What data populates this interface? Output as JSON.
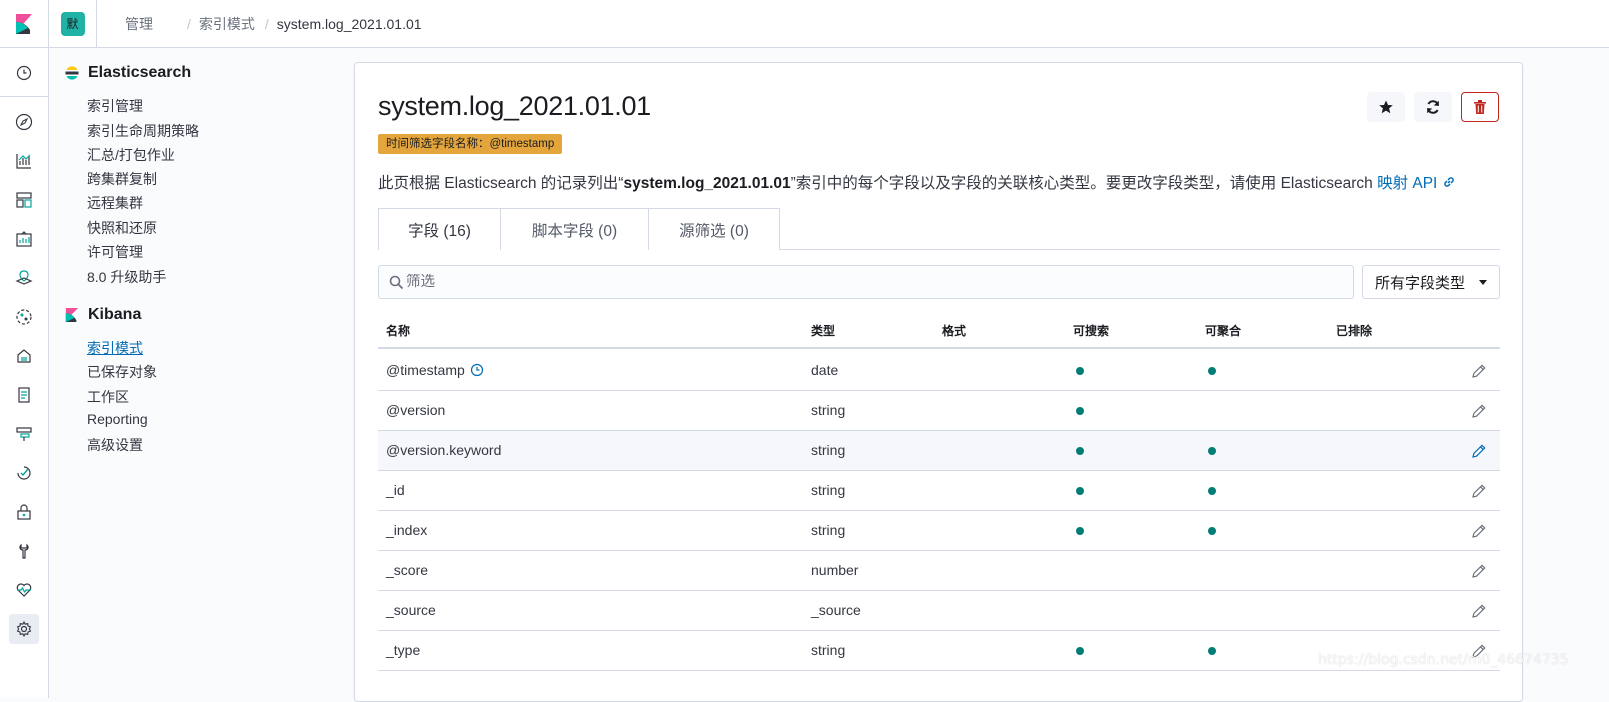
{
  "topbar": {
    "space_initial": "默",
    "breadcrumbs": [
      "管理",
      "索引模式",
      "system.log_2021.01.01"
    ]
  },
  "colors": {
    "accent": "#006bb4",
    "space": "#20b2a5",
    "badge": "#e4a63c",
    "success_dot": "#017d73",
    "danger": "#bd271e"
  },
  "sidenav": {
    "icons": [
      "clock-icon",
      "compass-icon",
      "visualize-icon",
      "dashboard-icon",
      "canvas-icon",
      "maps-icon",
      "ml-icon",
      "infrastructure-icon",
      "logs-icon",
      "apm-icon",
      "uptime-icon",
      "siem-icon",
      "dev-tools-icon",
      "monitoring-icon",
      "management-icon"
    ]
  },
  "menu": {
    "elasticsearch": {
      "title": "Elasticsearch",
      "items": [
        "索引管理",
        "索引生命周期策略",
        "汇总/打包作业",
        "跨集群复制",
        "远程集群",
        "快照和还原",
        "许可管理",
        "8.0 升级助手"
      ]
    },
    "kibana": {
      "title": "Kibana",
      "items": [
        "索引模式",
        "已保存对象",
        "工作区",
        "Reporting",
        "高级设置"
      ],
      "active_index": 0
    }
  },
  "main": {
    "title": "system.log_2021.01.01",
    "badge": "时间筛选字段名称：@timestamp",
    "desc_prefix": "此页根据 Elasticsearch 的记录列出“",
    "desc_bold": "system.log_2021.01.01",
    "desc_suffix": "”索引中的每个字段以及字段的关联核心类型。要更改字段类型，请使用 Elasticsearch ",
    "desc_link": "映射 API",
    "tabs": [
      "字段 (16)",
      "脚本字段 (0)",
      "源筛选 (0)"
    ],
    "search_placeholder": "筛选",
    "type_select": "所有字段类型",
    "columns": [
      "名称",
      "类型",
      "格式",
      "可搜索",
      "可聚合",
      "已排除"
    ],
    "rows": [
      {
        "name": "@timestamp",
        "type": "date",
        "format": "",
        "searchable": true,
        "aggregatable": true,
        "excluded": false,
        "time_icon": true
      },
      {
        "name": "@version",
        "type": "string",
        "format": "",
        "searchable": true,
        "aggregatable": false,
        "excluded": false
      },
      {
        "name": "@version.keyword",
        "type": "string",
        "format": "",
        "searchable": true,
        "aggregatable": true,
        "excluded": false
      },
      {
        "name": "_id",
        "type": "string",
        "format": "",
        "searchable": true,
        "aggregatable": true,
        "excluded": false
      },
      {
        "name": "_index",
        "type": "string",
        "format": "",
        "searchable": true,
        "aggregatable": true,
        "excluded": false
      },
      {
        "name": "_score",
        "type": "number",
        "format": "",
        "searchable": false,
        "aggregatable": false,
        "excluded": false
      },
      {
        "name": "_source",
        "type": "_source",
        "format": "",
        "searchable": false,
        "aggregatable": false,
        "excluded": false
      },
      {
        "name": "_type",
        "type": "string",
        "format": "",
        "searchable": true,
        "aggregatable": true,
        "excluded": false
      }
    ]
  },
  "watermark": "https://blog.csdn.net/m0_46674735"
}
